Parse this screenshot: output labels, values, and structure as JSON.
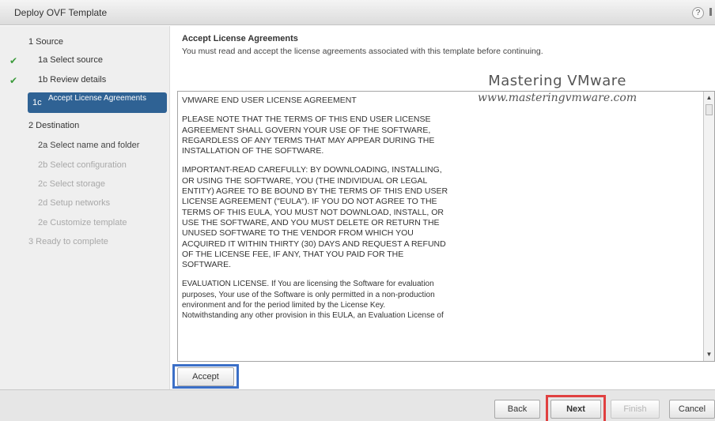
{
  "window": {
    "title": "Deploy OVF Template",
    "help_glyph": "?"
  },
  "sidebar": {
    "sections": [
      {
        "label": "1 Source"
      },
      {
        "label": "2 Destination"
      }
    ],
    "items": [
      {
        "label": "1a Select source",
        "completed": true
      },
      {
        "label": "1b Review details",
        "completed": true
      },
      {
        "num": "1c",
        "label": "Accept License Agreements",
        "active": true
      },
      {
        "label": "2a Select name and folder"
      },
      {
        "label": "2b Select configuration",
        "disabled": true
      },
      {
        "label": "2c Select storage",
        "disabled": true
      },
      {
        "label": "2d Setup networks",
        "disabled": true
      },
      {
        "label": "2e Customize template",
        "disabled": true
      },
      {
        "label": "3 Ready to complete",
        "disabled": true
      }
    ],
    "check_glyph": "✔"
  },
  "content": {
    "heading": "Accept License Agreements",
    "description": "You must read and accept the license agreements associated with this template before continuing."
  },
  "watermark": {
    "line1": "Mastering VMware",
    "line2": "www.masteringvmware.com"
  },
  "eula": {
    "paragraphs": [
      "VMWARE END USER LICENSE AGREEMENT",
      "PLEASE NOTE THAT THE TERMS OF THIS END USER LICENSE\nAGREEMENT SHALL GOVERN YOUR USE OF THE SOFTWARE,\nREGARDLESS OF ANY TERMS THAT MAY APPEAR DURING THE\nINSTALLATION OF THE SOFTWARE.",
      "IMPORTANT-READ CAREFULLY:  BY DOWNLOADING, INSTALLING,\nOR USING THE SOFTWARE, YOU (THE INDIVIDUAL OR LEGAL\nENTITY) AGREE TO BE BOUND BY THE TERMS OF THIS END USER\nLICENSE AGREEMENT (\"EULA\").  IF YOU DO NOT AGREE TO THE\nTERMS OF THIS EULA, YOU MUST NOT DOWNLOAD, INSTALL, OR\nUSE THE SOFTWARE, AND YOU MUST DELETE OR RETURN THE\nUNUSED SOFTWARE TO THE VENDOR FROM WHICH YOU\nACQUIRED IT WITHIN THIRTY (30) DAYS AND REQUEST A REFUND\nOF THE LICENSE FEE, IF ANY, THAT YOU PAID FOR THE\nSOFTWARE.",
      "EVALUATION LICENSE.  If You are licensing the Software for evaluation\npurposes, Your use of the Software is only permitted in a non-production\nenvironment and for the period limited by the License Key.\nNotwithstanding any other provision in this EULA, an Evaluation License of"
    ]
  },
  "buttons": {
    "accept": "Accept",
    "back": "Back",
    "next": "Next",
    "finish": "Finish",
    "cancel": "Cancel"
  },
  "colors": {
    "active_nav": "#2f6294",
    "check": "#3c9b3c",
    "accept_highlight": "#3b6fc7",
    "next_highlight": "#e04040"
  }
}
